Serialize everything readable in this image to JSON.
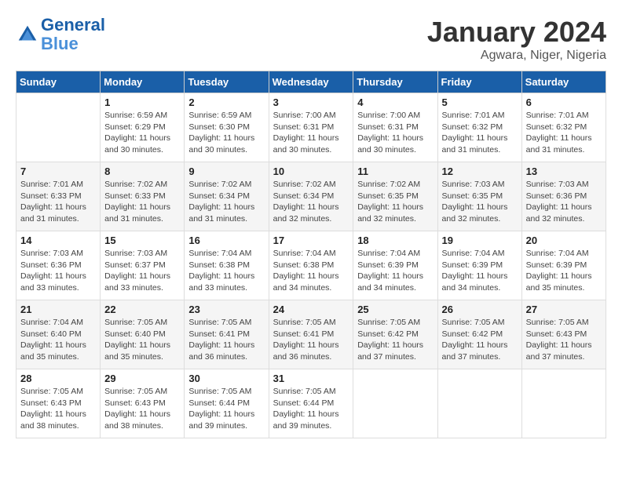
{
  "header": {
    "logo_line1": "General",
    "logo_line2": "Blue",
    "month": "January 2024",
    "location": "Agwara, Niger, Nigeria"
  },
  "days_of_week": [
    "Sunday",
    "Monday",
    "Tuesday",
    "Wednesday",
    "Thursday",
    "Friday",
    "Saturday"
  ],
  "weeks": [
    [
      {
        "day": "",
        "info": ""
      },
      {
        "day": "1",
        "info": "Sunrise: 6:59 AM\nSunset: 6:29 PM\nDaylight: 11 hours\nand 30 minutes."
      },
      {
        "day": "2",
        "info": "Sunrise: 6:59 AM\nSunset: 6:30 PM\nDaylight: 11 hours\nand 30 minutes."
      },
      {
        "day": "3",
        "info": "Sunrise: 7:00 AM\nSunset: 6:31 PM\nDaylight: 11 hours\nand 30 minutes."
      },
      {
        "day": "4",
        "info": "Sunrise: 7:00 AM\nSunset: 6:31 PM\nDaylight: 11 hours\nand 30 minutes."
      },
      {
        "day": "5",
        "info": "Sunrise: 7:01 AM\nSunset: 6:32 PM\nDaylight: 11 hours\nand 31 minutes."
      },
      {
        "day": "6",
        "info": "Sunrise: 7:01 AM\nSunset: 6:32 PM\nDaylight: 11 hours\nand 31 minutes."
      }
    ],
    [
      {
        "day": "7",
        "info": "Sunrise: 7:01 AM\nSunset: 6:33 PM\nDaylight: 11 hours\nand 31 minutes."
      },
      {
        "day": "8",
        "info": "Sunrise: 7:02 AM\nSunset: 6:33 PM\nDaylight: 11 hours\nand 31 minutes."
      },
      {
        "day": "9",
        "info": "Sunrise: 7:02 AM\nSunset: 6:34 PM\nDaylight: 11 hours\nand 31 minutes."
      },
      {
        "day": "10",
        "info": "Sunrise: 7:02 AM\nSunset: 6:34 PM\nDaylight: 11 hours\nand 32 minutes."
      },
      {
        "day": "11",
        "info": "Sunrise: 7:02 AM\nSunset: 6:35 PM\nDaylight: 11 hours\nand 32 minutes."
      },
      {
        "day": "12",
        "info": "Sunrise: 7:03 AM\nSunset: 6:35 PM\nDaylight: 11 hours\nand 32 minutes."
      },
      {
        "day": "13",
        "info": "Sunrise: 7:03 AM\nSunset: 6:36 PM\nDaylight: 11 hours\nand 32 minutes."
      }
    ],
    [
      {
        "day": "14",
        "info": "Sunrise: 7:03 AM\nSunset: 6:36 PM\nDaylight: 11 hours\nand 33 minutes."
      },
      {
        "day": "15",
        "info": "Sunrise: 7:03 AM\nSunset: 6:37 PM\nDaylight: 11 hours\nand 33 minutes."
      },
      {
        "day": "16",
        "info": "Sunrise: 7:04 AM\nSunset: 6:38 PM\nDaylight: 11 hours\nand 33 minutes."
      },
      {
        "day": "17",
        "info": "Sunrise: 7:04 AM\nSunset: 6:38 PM\nDaylight: 11 hours\nand 34 minutes."
      },
      {
        "day": "18",
        "info": "Sunrise: 7:04 AM\nSunset: 6:39 PM\nDaylight: 11 hours\nand 34 minutes."
      },
      {
        "day": "19",
        "info": "Sunrise: 7:04 AM\nSunset: 6:39 PM\nDaylight: 11 hours\nand 34 minutes."
      },
      {
        "day": "20",
        "info": "Sunrise: 7:04 AM\nSunset: 6:39 PM\nDaylight: 11 hours\nand 35 minutes."
      }
    ],
    [
      {
        "day": "21",
        "info": "Sunrise: 7:04 AM\nSunset: 6:40 PM\nDaylight: 11 hours\nand 35 minutes."
      },
      {
        "day": "22",
        "info": "Sunrise: 7:05 AM\nSunset: 6:40 PM\nDaylight: 11 hours\nand 35 minutes."
      },
      {
        "day": "23",
        "info": "Sunrise: 7:05 AM\nSunset: 6:41 PM\nDaylight: 11 hours\nand 36 minutes."
      },
      {
        "day": "24",
        "info": "Sunrise: 7:05 AM\nSunset: 6:41 PM\nDaylight: 11 hours\nand 36 minutes."
      },
      {
        "day": "25",
        "info": "Sunrise: 7:05 AM\nSunset: 6:42 PM\nDaylight: 11 hours\nand 37 minutes."
      },
      {
        "day": "26",
        "info": "Sunrise: 7:05 AM\nSunset: 6:42 PM\nDaylight: 11 hours\nand 37 minutes."
      },
      {
        "day": "27",
        "info": "Sunrise: 7:05 AM\nSunset: 6:43 PM\nDaylight: 11 hours\nand 37 minutes."
      }
    ],
    [
      {
        "day": "28",
        "info": "Sunrise: 7:05 AM\nSunset: 6:43 PM\nDaylight: 11 hours\nand 38 minutes."
      },
      {
        "day": "29",
        "info": "Sunrise: 7:05 AM\nSunset: 6:43 PM\nDaylight: 11 hours\nand 38 minutes."
      },
      {
        "day": "30",
        "info": "Sunrise: 7:05 AM\nSunset: 6:44 PM\nDaylight: 11 hours\nand 39 minutes."
      },
      {
        "day": "31",
        "info": "Sunrise: 7:05 AM\nSunset: 6:44 PM\nDaylight: 11 hours\nand 39 minutes."
      },
      {
        "day": "",
        "info": ""
      },
      {
        "day": "",
        "info": ""
      },
      {
        "day": "",
        "info": ""
      }
    ]
  ]
}
